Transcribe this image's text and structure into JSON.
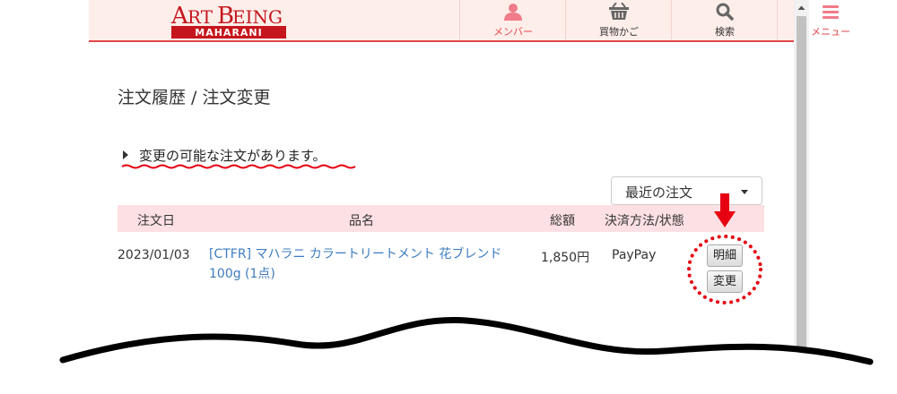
{
  "header": {
    "logo_line1": "ArtBeing",
    "logo_line2": "MAHARANI",
    "nav": [
      {
        "label": "メンバー",
        "icon": "person-icon"
      },
      {
        "label": "買物かご",
        "icon": "basket-icon"
      },
      {
        "label": "検索",
        "icon": "search-icon"
      },
      {
        "label": "メニュー",
        "icon": "menu-icon"
      }
    ]
  },
  "page": {
    "title": "注文履歴 / 注文変更",
    "notice": "変更の可能な注文があります。",
    "filter_selected": "最近の注文"
  },
  "table": {
    "headers": [
      "注文日",
      "品名",
      "総額",
      "決済方法/状態"
    ],
    "rows": [
      {
        "date": "2023/01/03",
        "product": "[CTFR] マハラニ カラートリートメント 花ブレンド 100g (1点)",
        "total": "1,850円",
        "payment": "PayPay",
        "detail_button": "明細",
        "change_button": "変更"
      }
    ]
  },
  "colors": {
    "accent": "#e3464b",
    "header_bg": "#fdeeea",
    "table_header_bg": "#fde0e3",
    "link": "#3d7cc0",
    "annotation_red": "#e60012"
  }
}
